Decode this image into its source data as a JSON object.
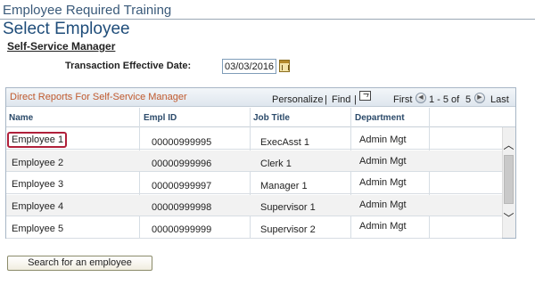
{
  "header": {
    "breadcrumb": "Employee Required Training",
    "page_title": "Select Employee",
    "section_title": "Self-Service Manager"
  },
  "transaction": {
    "label": "Transaction Effective Date:",
    "value": "03/03/2016",
    "icon": "calendar-icon"
  },
  "grid": {
    "caption": "Direct Reports For Self-Service Manager",
    "personalize": "Personalize",
    "separator": "|",
    "find": "Find",
    "first": "First",
    "range": "1 - 5",
    "of_label": "of",
    "total": "5",
    "last": "Last",
    "columns": [
      "Name",
      "Empl ID",
      "Job Title",
      "Department"
    ],
    "rows": [
      {
        "name": "Employee 1",
        "empl_id": "00000999995",
        "job_title": "ExecAsst 1",
        "department": "Admin Mgt"
      },
      {
        "name": "Employee 2",
        "empl_id": "00000999996",
        "job_title": "Clerk 1",
        "department": "Admin Mgt"
      },
      {
        "name": "Employee 3",
        "empl_id": "00000999997",
        "job_title": "Manager 1",
        "department": "Admin Mgt"
      },
      {
        "name": "Employee 4",
        "empl_id": "00000999998",
        "job_title": "Supervisor 1",
        "department": "Admin Mgt"
      },
      {
        "name": "Employee 5",
        "empl_id": "00000999999",
        "job_title": "Supervisor 2",
        "department": "Admin Mgt"
      }
    ],
    "highlight_color": "#b0203a"
  },
  "actions": {
    "search_label": "Search for an employee"
  }
}
